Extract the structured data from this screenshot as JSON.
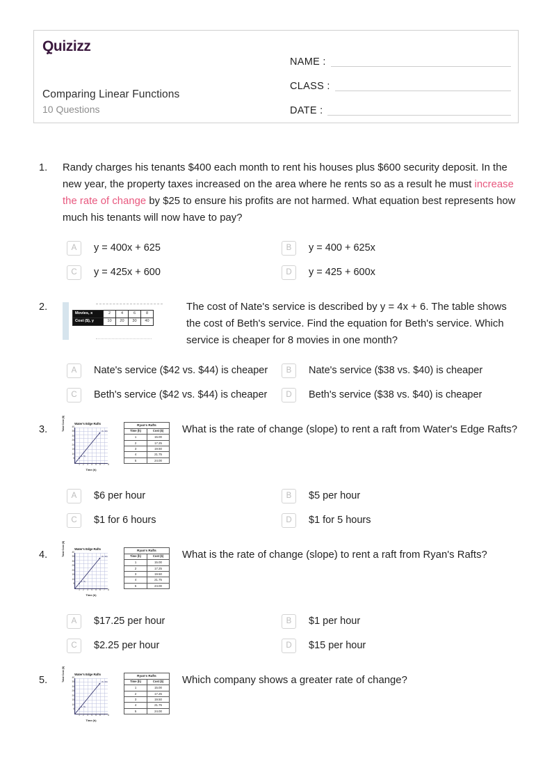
{
  "header": {
    "logo_text": "Quizizz",
    "quiz_title": "Comparing Linear Functions",
    "question_count": "10 Questions",
    "fields": [
      {
        "label": "NAME :"
      },
      {
        "label": "CLASS :"
      },
      {
        "label": "DATE  :"
      }
    ]
  },
  "figures": {
    "movies_table": {
      "rows": [
        {
          "head": "Movies, x",
          "values": [
            "2",
            "4",
            "6",
            "8"
          ]
        },
        {
          "head": "Cost ($), y",
          "values": [
            "10",
            "20",
            "30",
            "40"
          ]
        }
      ]
    },
    "waters_edge_graph": {
      "title": "Water's Edge Rafts",
      "ylabel": "Total Cost ($)",
      "xlabel": "Time (h)",
      "yticks": [
        "40",
        "35",
        "30",
        "25",
        "20",
        "15",
        "10",
        "5"
      ],
      "xticks": [
        "1",
        "2",
        "3",
        "4",
        "5",
        "6",
        "7",
        "8"
      ],
      "point_low": "(1, 5)",
      "point_high": "(6, 30)"
    },
    "ryans_rafts_table": {
      "caption": "Ryan's Rafts",
      "columns": [
        "Time (h)",
        "Cost ($)"
      ],
      "rows": [
        [
          "1",
          "15.00"
        ],
        [
          "2",
          "17.25"
        ],
        [
          "3",
          "19.50"
        ],
        [
          "4",
          "21.75"
        ],
        [
          "5",
          "24.00"
        ]
      ]
    }
  },
  "questions": [
    {
      "number": "1.",
      "text_before": "Randy charges his tenants $400 each month to rent his houses plus $600 security deposit. In the new year, the property taxes increased on the area where he rents so as a result he must ",
      "text_highlight": "increase the rate of change",
      "text_after": " by $25 to ensure his profits are not harmed. What equation best represents how much his tenants will now have to pay?",
      "options": [
        {
          "letter": "A",
          "text": "y = 400x + 625"
        },
        {
          "letter": "B",
          "text": "y = 400 + 625x"
        },
        {
          "letter": "C",
          "text": "y = 425x + 600"
        },
        {
          "letter": "D",
          "text": "y = 425 + 600x"
        }
      ]
    },
    {
      "number": "2.",
      "text": "The cost of Nate's service is described by y = 4x + 6. The table shows the cost of Beth's service. Find the equation for Beth's service.  Which service is cheaper for 8 movies in one month?",
      "options": [
        {
          "letter": "A",
          "text": "Nate's service ($42 vs. $44) is cheaper"
        },
        {
          "letter": "B",
          "text": "Nate's service ($38 vs. $40) is cheaper"
        },
        {
          "letter": "C",
          "text": "Beth's service ($42 vs. $44) is cheaper"
        },
        {
          "letter": "D",
          "text": "Beth's service ($38 vs. $40) is cheaper"
        }
      ]
    },
    {
      "number": "3.",
      "text": "What is the rate of change (slope) to rent a raft from Water's Edge Rafts?",
      "options": [
        {
          "letter": "A",
          "text": "$6 per hour"
        },
        {
          "letter": "B",
          "text": "$5 per hour"
        },
        {
          "letter": "C",
          "text": "$1 for 6 hours"
        },
        {
          "letter": "D",
          "text": "$1 for 5 hours"
        }
      ]
    },
    {
      "number": "4.",
      "text": "What is the rate of change (slope) to rent a raft from Ryan's Rafts?",
      "options": [
        {
          "letter": "A",
          "text": "$17.25 per hour"
        },
        {
          "letter": "B",
          "text": "$1 per hour"
        },
        {
          "letter": "C",
          "text": "$2.25 per hour"
        },
        {
          "letter": "D",
          "text": "$15 per hour"
        }
      ]
    },
    {
      "number": "5.",
      "text": "Which company shows a greater rate of change?",
      "options": []
    }
  ],
  "colors": {
    "logo_purple": "#3c1a3f",
    "highlight_pink": "#e8577e",
    "border_gray": "#cfcfcf",
    "muted_gray": "#8d8d8d"
  }
}
